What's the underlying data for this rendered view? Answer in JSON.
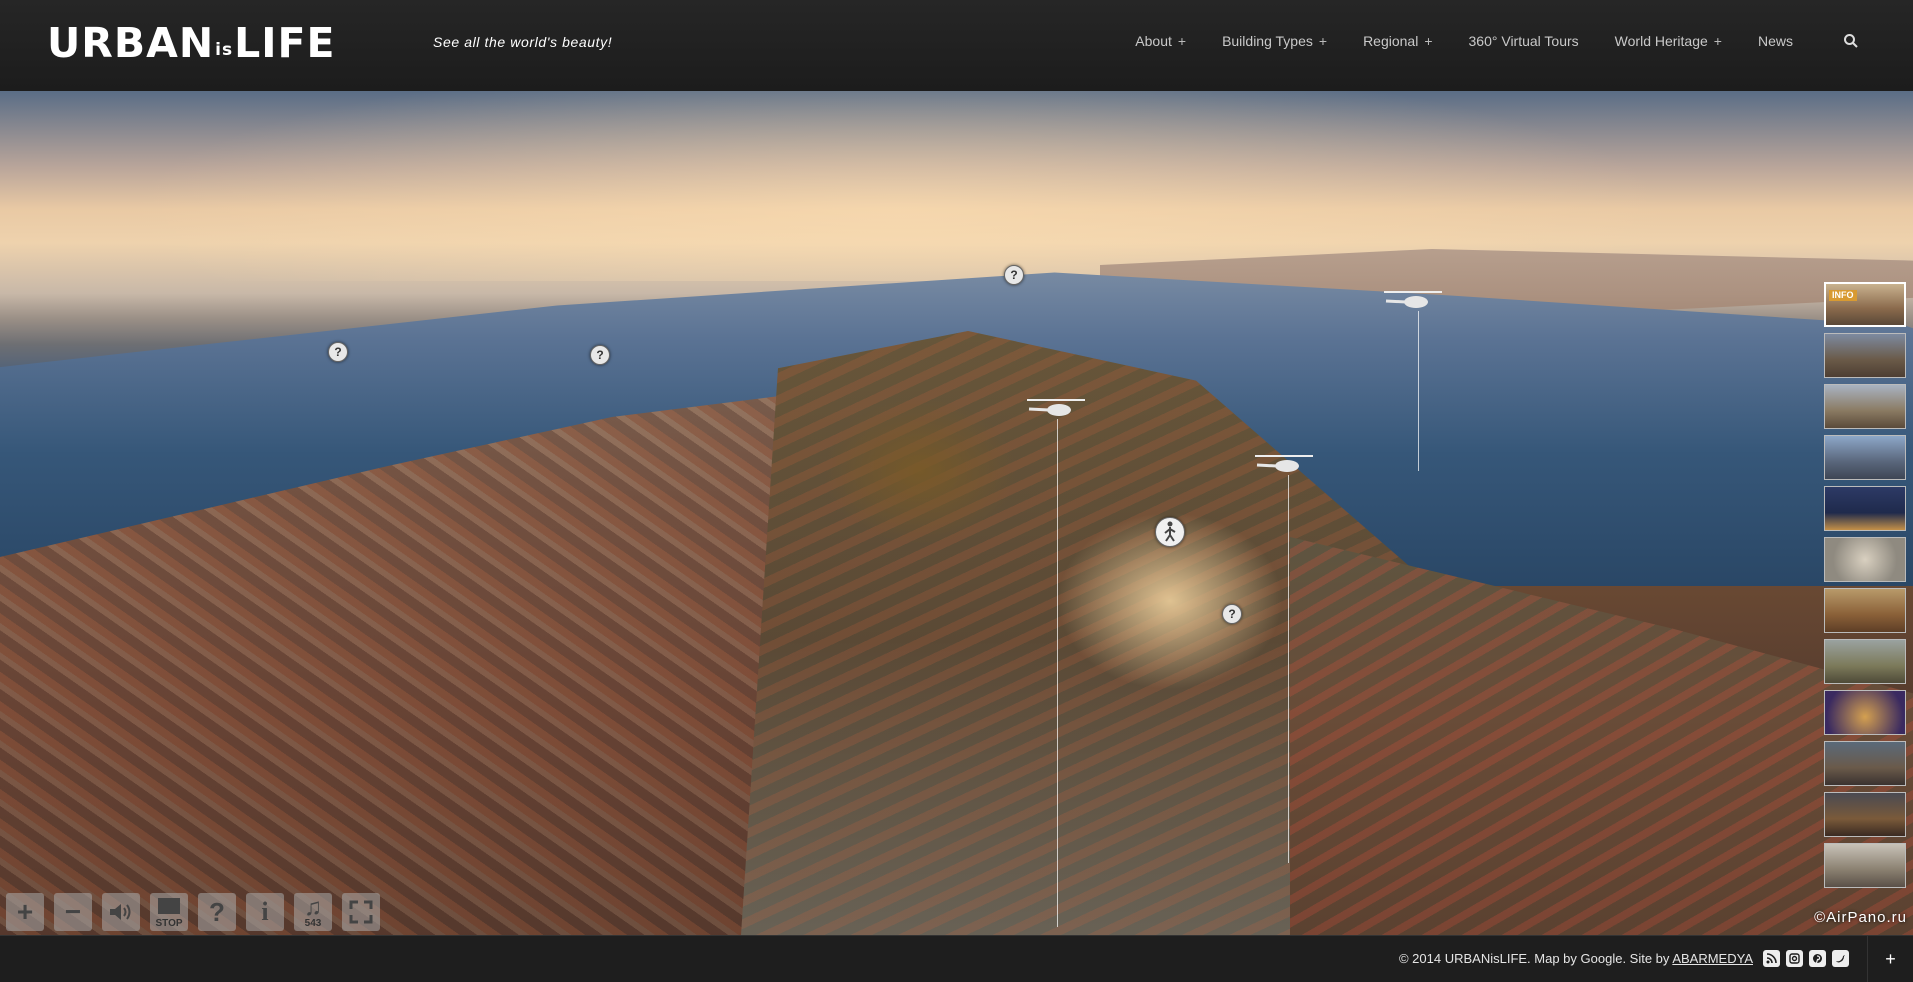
{
  "header": {
    "logo": {
      "part1": "URBAN",
      "part2": "is",
      "part3": "LIFE"
    },
    "tagline": "See all the world's beauty!",
    "nav": [
      {
        "label": "About",
        "has_sub": "+"
      },
      {
        "label": "Building Types",
        "has_sub": "+"
      },
      {
        "label": "Regional",
        "has_sub": "+"
      },
      {
        "label": "360° Virtual Tours",
        "has_sub": ""
      },
      {
        "label": "World Heritage",
        "has_sub": "+"
      },
      {
        "label": "News",
        "has_sub": ""
      }
    ],
    "search_icon": "search-icon"
  },
  "panorama": {
    "hotspot_glyph": "?",
    "thumbnails": [
      {
        "badge": "INFO"
      },
      {},
      {},
      {},
      {},
      {},
      {},
      {},
      {},
      {},
      {},
      {}
    ],
    "controls": [
      {
        "icon": "zoom-in-icon",
        "glyph": "+"
      },
      {
        "icon": "zoom-out-icon",
        "glyph": "−"
      },
      {
        "icon": "sound-icon",
        "glyph": "🔊"
      },
      {
        "icon": "stop-icon",
        "glyph": "STOP"
      },
      {
        "icon": "help-icon",
        "glyph": "?"
      },
      {
        "icon": "info-icon",
        "glyph": "i"
      },
      {
        "icon": "music-icon",
        "glyph": "♫",
        "sub": "543"
      },
      {
        "icon": "fullscreen-icon",
        "glyph": "⤢"
      }
    ],
    "watermark": "©AirPano.ru"
  },
  "footer": {
    "text": "© 2014 URBANisLIFE. Map by Google. Site by",
    "link": "ABARMEDYA",
    "social": [
      "rss-icon",
      "instagram-icon",
      "pinterest-icon",
      "twitter-icon"
    ],
    "toggle": "+"
  }
}
